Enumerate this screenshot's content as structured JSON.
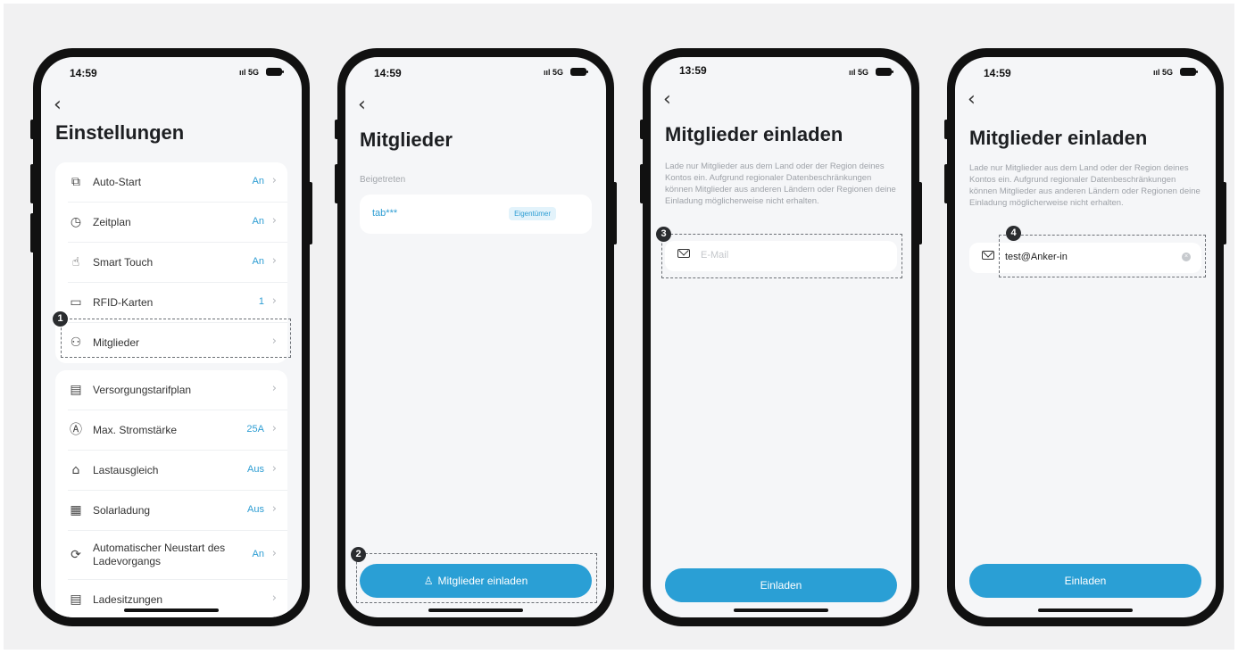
{
  "phones": [
    {
      "status_time": "14:59",
      "network": "5G",
      "title": "Einstellungen",
      "group1": [
        {
          "icon": "auto-start-icon",
          "label": "Auto-Start",
          "value": "An"
        },
        {
          "icon": "clock-icon",
          "label": "Zeitplan",
          "value": "An"
        },
        {
          "icon": "touch-icon",
          "label": "Smart Touch",
          "value": "An"
        },
        {
          "icon": "rfid-card-icon",
          "label": "RFID-Karten",
          "value": "1"
        },
        {
          "icon": "members-icon",
          "label": "Mitglieder",
          "value": ""
        }
      ],
      "group2": [
        {
          "icon": "tariff-icon",
          "label": "Versorgungstarifplan",
          "value": ""
        },
        {
          "icon": "amperage-icon",
          "label": "Max. Stromstärke",
          "value": "25A"
        },
        {
          "icon": "load-balance-icon",
          "label": "Lastausgleich",
          "value": "Aus"
        },
        {
          "icon": "solar-icon",
          "label": "Solarladung",
          "value": "Aus"
        },
        {
          "icon": "restart-icon",
          "label": "Automatischer Neustart des Ladevorgangs",
          "value": "An"
        },
        {
          "icon": "sessions-icon",
          "label": "Ladesitzungen",
          "value": ""
        }
      ],
      "step": "1"
    },
    {
      "status_time": "14:59",
      "network": "5G",
      "title": "Mitglieder",
      "section": "Beigetreten",
      "member_name": "tab***",
      "member_role": "Eigentümer",
      "button": "Mitglieder einladen",
      "step": "2"
    },
    {
      "status_time": "13:59",
      "network": "5G",
      "title": "Mitglieder einladen",
      "description": "Lade nur Mitglieder aus dem Land oder der Region deines Kontos ein. Aufgrund regionaler Datenbeschränkungen können Mitglieder aus anderen Ländern oder Regionen deine Einladung möglicherweise nicht erhalten.",
      "placeholder": "E-Mail",
      "button": "Einladen",
      "step": "3"
    },
    {
      "status_time": "14:59",
      "network": "5G",
      "title": "Mitglieder einladen",
      "description": "Lade nur Mitglieder aus dem Land oder der Region deines Kontos ein. Aufgrund regionaler Datenbeschränkungen können Mitglieder aus anderen Ländern oder Regionen deine Einladung möglicherweise nicht erhalten.",
      "email_value": "test@Anker-in",
      "button": "Einladen",
      "step": "4"
    }
  ],
  "colors": {
    "accent": "#2a9fd5",
    "frame": "#111111",
    "screen": "#f5f6f8"
  }
}
